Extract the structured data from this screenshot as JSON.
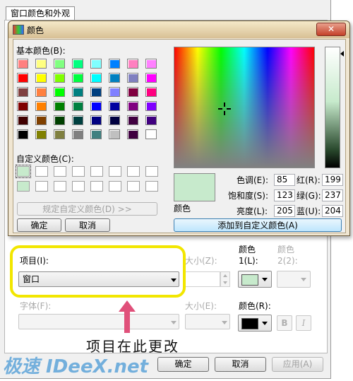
{
  "back_window": {
    "tab_title": "窗口颜色和外观",
    "item_label": "项目(I):",
    "item_value": "窗口",
    "size_label": "大小(Z):",
    "color1_label_top": "颜色",
    "color1_label_bottom": "1(L):",
    "color2_label_top": "颜色",
    "color2_label_bottom": "2(2):",
    "font_label": "字体(F):",
    "font_size_label": "大小(E):",
    "font_color_label": "颜色(R):",
    "bold_label": "B",
    "italic_label": "I",
    "ok_button": "确定",
    "cancel_button": "取消",
    "apply_button": "应用(A)",
    "color1_value": "#c7eacc",
    "font_color_value": "#000000"
  },
  "color_dialog": {
    "title": "颜色",
    "basic_colors_label": "基本颜色(B):",
    "basic_colors": [
      [
        "#ff8080",
        "#ffff80",
        "#80ff80",
        "#00ff80",
        "#80ffff",
        "#0080ff",
        "#ff80c0",
        "#ff80ff"
      ],
      [
        "#ff0000",
        "#ffff00",
        "#80ff00",
        "#00ff40",
        "#00ffff",
        "#0080c0",
        "#8080c0",
        "#ff00ff"
      ],
      [
        "#804040",
        "#ff8040",
        "#00ff00",
        "#008080",
        "#004080",
        "#8080ff",
        "#800040",
        "#ff0080"
      ],
      [
        "#800000",
        "#ff8000",
        "#008000",
        "#008040",
        "#0000ff",
        "#0000a0",
        "#800080",
        "#8000ff"
      ],
      [
        "#400000",
        "#804000",
        "#004000",
        "#004040",
        "#000080",
        "#000040",
        "#400040",
        "#400080"
      ],
      [
        "#000000",
        "#808000",
        "#808040",
        "#808080",
        "#408080",
        "#c0c0c0",
        "#400040",
        "#ffffff"
      ]
    ],
    "custom_colors_label": "自定义颜色(C):",
    "custom_colors": [
      "#c7eacc",
      "#ffffff",
      "#ffffff",
      "#ffffff",
      "#ffffff",
      "#ffffff",
      "#ffffff",
      "#ffffff",
      "#c7eacc",
      "#ffffff",
      "#ffffff",
      "#ffffff",
      "#ffffff",
      "#ffffff",
      "#ffffff",
      "#ffffff"
    ],
    "define_custom_button": "规定自定义颜色(D) >>",
    "ok_button": "确定",
    "cancel_button": "取消",
    "preview_label": "颜色",
    "preview_color": "#c7eacc",
    "hue_label": "色调(E):",
    "hue_value": "85",
    "sat_label": "饱和度(S):",
    "sat_value": "123",
    "lum_label": "亮度(L):",
    "lum_value": "205",
    "red_label": "红(R):",
    "red_value": "199",
    "green_label": "绿(G):",
    "green_value": "237",
    "blue_label": "蓝(U):",
    "blue_value": "204",
    "add_custom_button": "添加到自定义颜色(A)"
  },
  "annotation": {
    "text": "项目在此更改",
    "highlight_color": "#f2e600",
    "arrow_color": "#e0507a"
  },
  "watermark": {
    "text": "极速 IDeeX.net"
  }
}
